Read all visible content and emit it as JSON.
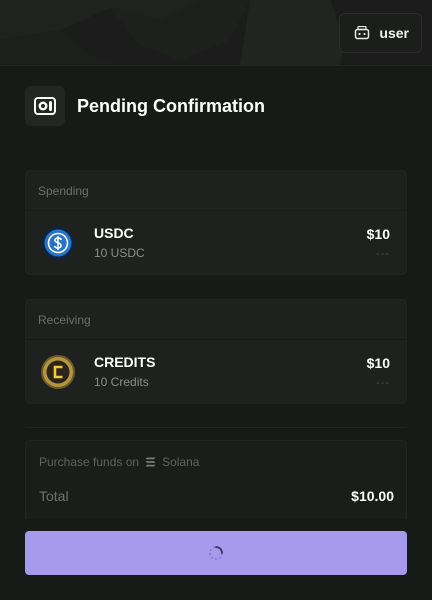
{
  "topbar": {
    "user_label": "user",
    "user_icon": "robot-icon"
  },
  "header": {
    "title": "Pending Confirmation",
    "logo_icon": "brand-logo-icon"
  },
  "spending": {
    "label": "Spending",
    "token": {
      "name": "USDC",
      "amount": "10 USDC",
      "value": "$10",
      "sub_value": "---",
      "icon": "usdc-icon",
      "color": "#2775ca"
    }
  },
  "receiving": {
    "label": "Receiving",
    "token": {
      "name": "CREDITS",
      "amount": "10 Credits",
      "value": "$10",
      "sub_value": "---",
      "icon": "credits-coin-icon",
      "color": "#c9a94a"
    }
  },
  "summary": {
    "network_text": "Purchase funds on",
    "network_name": "Solana",
    "network_icon": "solana-icon",
    "total_label": "Total",
    "total_value": "$10.00"
  },
  "confirm_button": {
    "state": "loading",
    "icon": "spinner-icon",
    "color": "#a799ec"
  }
}
